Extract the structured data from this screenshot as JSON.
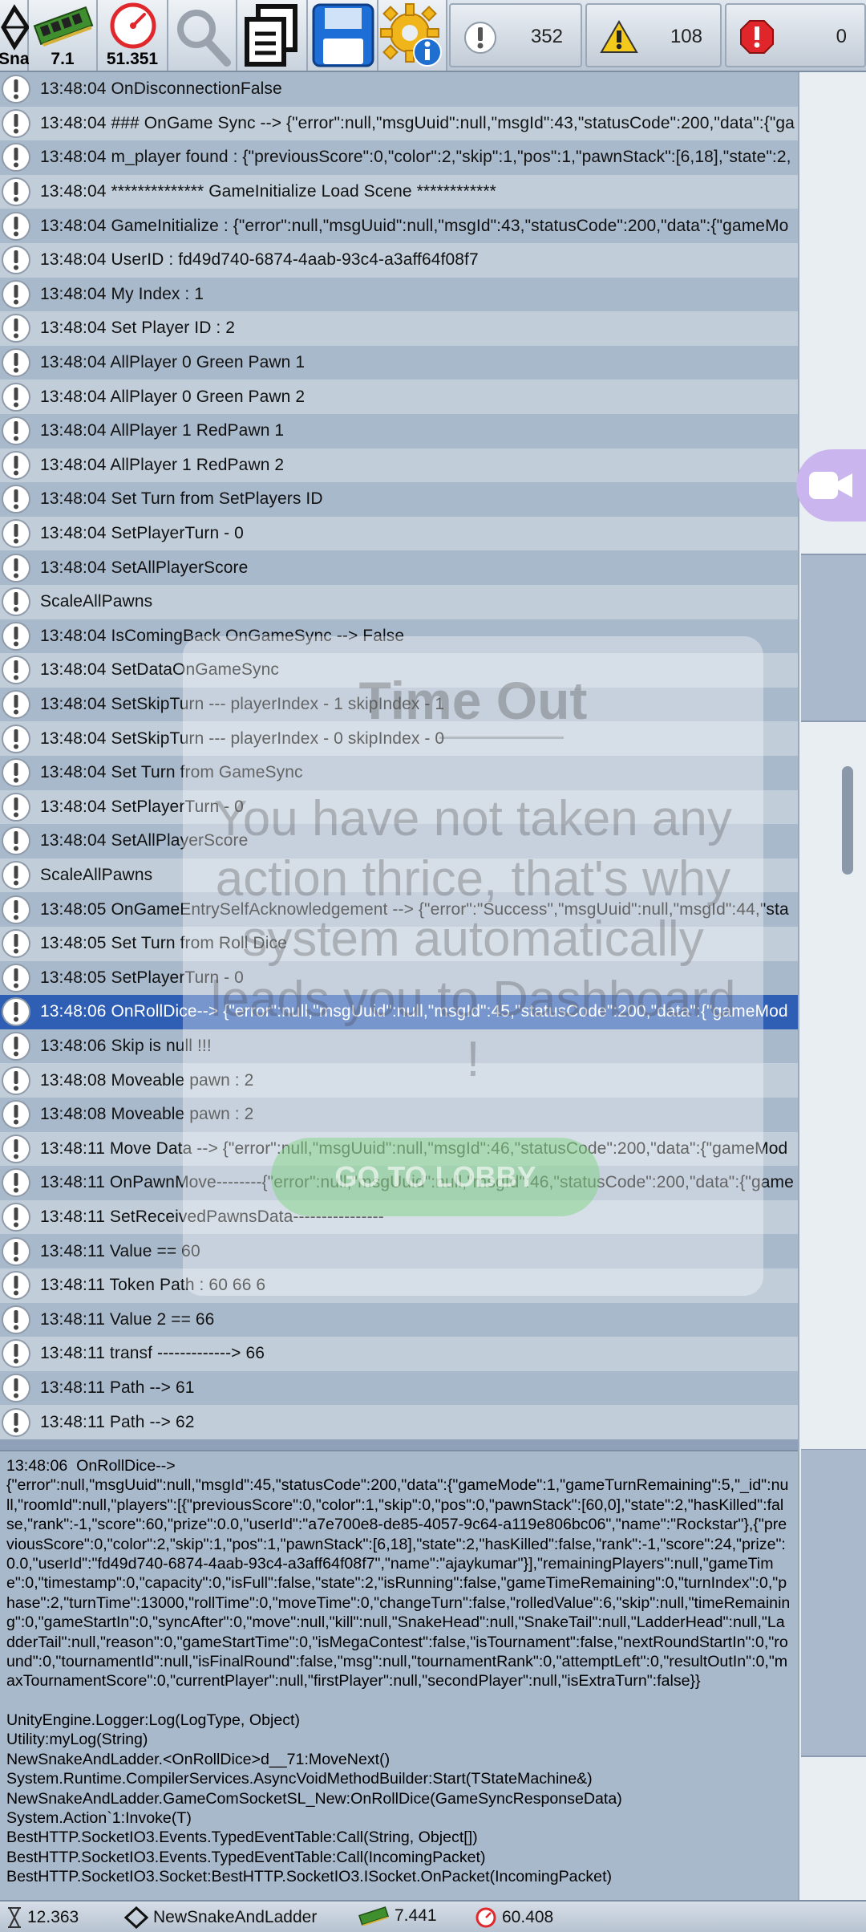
{
  "toolbar": {
    "app_caption": "Sna",
    "memory_value": "7.1",
    "fps_value": "51.351",
    "log_count": "352",
    "warning_count": "108",
    "error_count": "0"
  },
  "overlay": {
    "title": "Time Out",
    "message": "You have not taken any action thrice, that's why system automatically leads you to Dashboard !",
    "button": "GO TO LOBBY"
  },
  "logs": [
    {
      "time": "13:48:04",
      "msg": "OnDisconnectionFalse"
    },
    {
      "time": "13:48:04",
      "msg": "### OnGame Sync -->  {\"error\":null,\"msgUuid\":null,\"msgId\":43,\"statusCode\":200,\"data\":{\"ga"
    },
    {
      "time": "13:48:04",
      "msg": "m_player found : {\"previousScore\":0,\"color\":2,\"skip\":1,\"pos\":1,\"pawnStack\":[6,18],\"state\":2,"
    },
    {
      "time": "13:48:04",
      "msg": "************** GameInitialize Load Scene ************"
    },
    {
      "time": "13:48:04",
      "msg": "GameInitialize : {\"error\":null,\"msgUuid\":null,\"msgId\":43,\"statusCode\":200,\"data\":{\"gameMo"
    },
    {
      "time": "13:48:04",
      "msg": "UserID  : fd49d740-6874-4aab-93c4-a3aff64f08f7"
    },
    {
      "time": "13:48:04",
      "msg": "My Index :  1"
    },
    {
      "time": "13:48:04",
      "msg": "Set Player ID : 2"
    },
    {
      "time": "13:48:04",
      "msg": "AllPlayer   0   Green Pawn 1"
    },
    {
      "time": "13:48:04",
      "msg": "AllPlayer   0   Green Pawn 2"
    },
    {
      "time": "13:48:04",
      "msg": "AllPlayer   1   RedPawn 1"
    },
    {
      "time": "13:48:04",
      "msg": "AllPlayer   1   RedPawn 2"
    },
    {
      "time": "13:48:04",
      "msg": "Set Turn from SetPlayers ID"
    },
    {
      "time": "13:48:04",
      "msg": "SetPlayerTurn - 0"
    },
    {
      "time": "13:48:04",
      "msg": "SetAllPlayerScore"
    },
    {
      "time": "",
      "msg": "ScaleAllPawns"
    },
    {
      "time": "13:48:04",
      "msg": "IsComingBack OnGameSync -->  False"
    },
    {
      "time": "13:48:04",
      "msg": "SetDataOnGameSync"
    },
    {
      "time": "13:48:04",
      "msg": "SetSkipTurn        --- playerIndex - 1 skipIndex -   1"
    },
    {
      "time": "13:48:04",
      "msg": "SetSkipTurn        --- playerIndex - 0 skipIndex -   0"
    },
    {
      "time": "13:48:04",
      "msg": "Set Turn from GameSync"
    },
    {
      "time": "13:48:04",
      "msg": "SetPlayerTurn - 0"
    },
    {
      "time": "13:48:04",
      "msg": "SetAllPlayerScore"
    },
    {
      "time": "",
      "msg": "ScaleAllPawns"
    },
    {
      "time": "13:48:05",
      "msg": "OnGameEntrySelfAcknowledgement --> {\"error\":\"Success\",\"msgUuid\":null,\"msgId\":44,\"sta"
    },
    {
      "time": "13:48:05",
      "msg": "Set Turn from Roll Dice"
    },
    {
      "time": "13:48:05",
      "msg": "SetPlayerTurn - 0"
    },
    {
      "time": "13:48:06",
      "msg": "OnRollDice--> {\"error\":null,\"msgUuid\":null,\"msgId\":45,\"statusCode\":200,\"data\":{\"gameMod",
      "selected": true
    },
    {
      "time": "13:48:06",
      "msg": "Skip is null !!!"
    },
    {
      "time": "13:48:08",
      "msg": "Moveable pawn :  2"
    },
    {
      "time": "13:48:08",
      "msg": "Moveable pawn :  2"
    },
    {
      "time": "13:48:11",
      "msg": "Move Data --> {\"error\":null,\"msgUuid\":null,\"msgId\":46,\"statusCode\":200,\"data\":{\"gameMod"
    },
    {
      "time": "13:48:11",
      "msg": "OnPawnMove--------{\"error\":null,\"msgUuid\":null,\"msgId\":46,\"statusCode\":200,\"data\":{\"game"
    },
    {
      "time": "13:48:11",
      "msg": "SetReceivedPawnsData----------------"
    },
    {
      "time": "13:48:11",
      "msg": "Value == 60"
    },
    {
      "time": "13:48:11",
      "msg": "Token Path   :  60  66  6"
    },
    {
      "time": "13:48:11",
      "msg": "Value 2 == 66"
    },
    {
      "time": "13:48:11",
      "msg": "transf  ------------->    66"
    },
    {
      "time": "13:48:11",
      "msg": "Path --> 61"
    },
    {
      "time": "13:48:11",
      "msg": "Path --> 62"
    }
  ],
  "detail": {
    "message": "13:48:06  OnRollDice-->\n{\"error\":null,\"msgUuid\":null,\"msgId\":45,\"statusCode\":200,\"data\":{\"gameMode\":1,\"gameTurnRemaining\":5,\"_id\":null,\"roomId\":null,\"players\":[{\"previousScore\":0,\"color\":1,\"skip\":0,\"pos\":0,\"pawnStack\":[60,0],\"state\":2,\"hasKilled\":false,\"rank\":-1,\"score\":60,\"prize\":0.0,\"userId\":\"a7e700e8-de85-4057-9c64-a119e806bc06\",\"name\":\"Rockstar\"},{\"previousScore\":0,\"color\":2,\"skip\":1,\"pos\":1,\"pawnStack\":[6,18],\"state\":2,\"hasKilled\":false,\"rank\":-1,\"score\":24,\"prize\":0.0,\"userId\":\"fd49d740-6874-4aab-93c4-a3aff64f08f7\",\"name\":\"ajaykumar\"}],\"remainingPlayers\":null,\"gameTime\":0,\"timestamp\":0,\"capacity\":0,\"isFull\":false,\"state\":2,\"isRunning\":false,\"gameTimeRemaining\":0,\"turnIndex\":0,\"phase\":2,\"turnTime\":13000,\"rollTime\":0,\"moveTime\":0,\"changeTurn\":false,\"rolledValue\":6,\"skip\":null,\"timeRemaining\":0,\"gameStartIn\":0,\"syncAfter\":0,\"move\":null,\"kill\":null,\"SnakeHead\":null,\"SnakeTail\":null,\"LadderHead\":null,\"LadderTail\":null,\"reason\":0,\"gameStartTime\":0,\"isMegaContest\":false,\"isTournament\":false,\"nextRoundStartIn\":0,\"round\":0,\"tournamentId\":null,\"isFinalRound\":false,\"msg\":null,\"tournamentRank\":0,\"attemptLeft\":0,\"resultOutIn\":0,\"maxTournamentScore\":0,\"currentPlayer\":null,\"firstPlayer\":null,\"secondPlayer\":null,\"isExtraTurn\":false}}",
    "stack": "UnityEngine.Logger:Log(LogType, Object)\nUtility:myLog(String)\nNewSnakeAndLadder.<OnRollDice>d__71:MoveNext()\nSystem.Runtime.CompilerServices.AsyncVoidMethodBuilder:Start(TStateMachine&)\nNewSnakeAndLadder.GameComSocketSL_New:OnRollDice(GameSyncResponseData)\nSystem.Action`1:Invoke(T)\nBestHTTP.SocketIO3.Events.TypedEventTable:Call(String, Object[])\nBestHTTP.SocketIO3.Events.TypedEventTable:Call(IncomingPacket)\nBestHTTP.SocketIO3.Socket:BestHTTP.SocketIO3.ISocket.OnPacket(IncomingPacket)"
  },
  "statusbar": {
    "time_value": "12.363",
    "app_name": "NewSnakeAndLadder",
    "memory_value": "7.441",
    "fps_value": "60.408"
  }
}
